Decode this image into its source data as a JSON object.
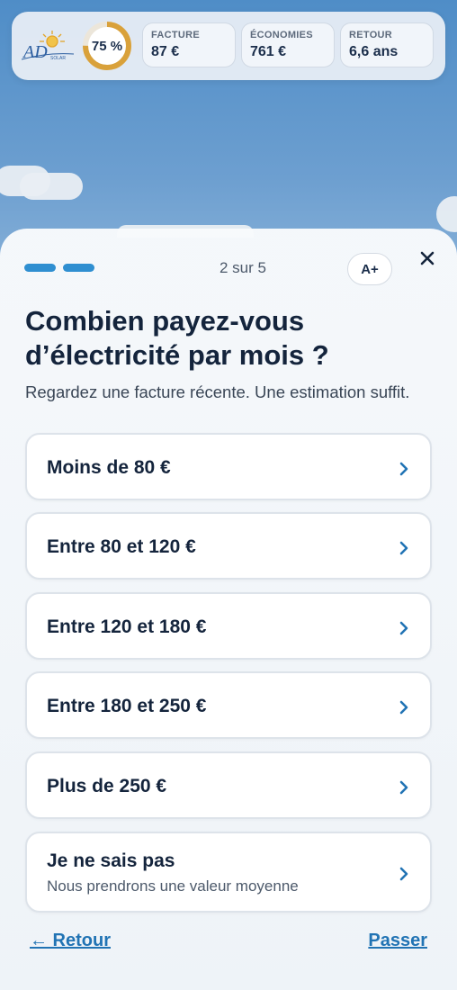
{
  "header": {
    "progress_percent": 75,
    "progress_label": "75 %",
    "stats": [
      {
        "label": "FACTURE",
        "value": "87 €"
      },
      {
        "label": "ÉCONOMIES",
        "value": "761 €"
      },
      {
        "label": "RETOUR",
        "value": "6,6 ans"
      }
    ],
    "ring_color": "#d9a13a"
  },
  "sheet": {
    "step_label": "2 sur 5",
    "font_button": "A+",
    "title": "Combien payez-vous d’électricité par mois ?",
    "subtitle": "Regardez une facture récente. Une estimation suffit.",
    "options": [
      {
        "label": "Moins de 80 €"
      },
      {
        "label": "Entre 80 et 120 €"
      },
      {
        "label": "Entre 120 et 180 €"
      },
      {
        "label": "Entre 180 et 250 €"
      },
      {
        "label": "Plus de 250 €"
      },
      {
        "label": "Je ne sais pas",
        "description": "Nous prendrons une valeur moyenne"
      }
    ],
    "back_label": "← Retour",
    "skip_label": "Passer",
    "accent": "#2f8fd1"
  }
}
